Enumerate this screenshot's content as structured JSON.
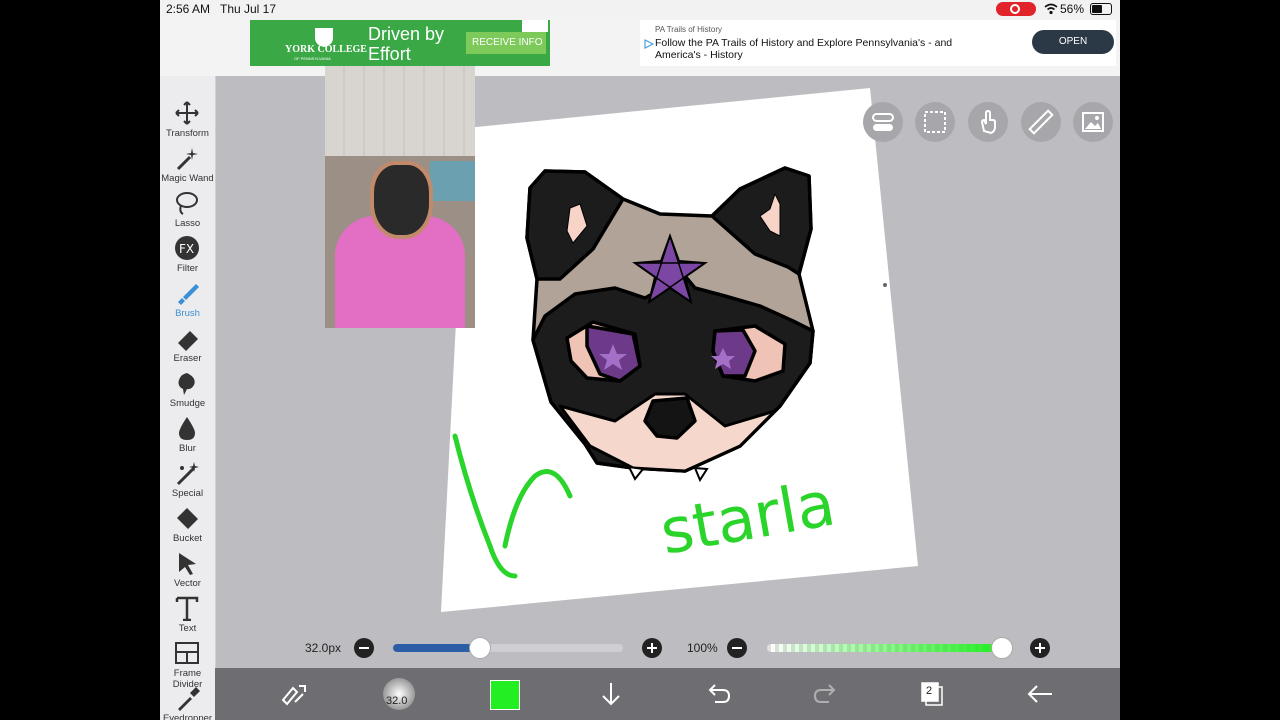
{
  "status": {
    "time": "2:56 AM",
    "date": "Thu Jul 17",
    "battery": "56%"
  },
  "ad_left": {
    "logo": "YORK COLLEGE",
    "logo_sub": "OF PENNSYLVANIA",
    "headline_1": "Driven by",
    "headline_2": "Effort",
    "cta": "RECEIVE INFO"
  },
  "ad_right": {
    "source": "PA Trails of History",
    "text_1": "Follow the PA Trails of History and Explore Pennsylvania's - and",
    "text_2": "America's - History",
    "cta": "OPEN"
  },
  "tools": [
    {
      "label": "Transform",
      "icon": "move-arrows-icon"
    },
    {
      "label": "Magic Wand",
      "icon": "magic-wand-icon"
    },
    {
      "label": "Lasso",
      "icon": "lasso-icon"
    },
    {
      "label": "Filter",
      "icon": "fx-icon"
    },
    {
      "label": "Brush",
      "icon": "brush-icon"
    },
    {
      "label": "Eraser",
      "icon": "eraser-icon"
    },
    {
      "label": "Smudge",
      "icon": "smudge-icon"
    },
    {
      "label": "Blur",
      "icon": "drop-icon"
    },
    {
      "label": "Special",
      "icon": "sparkle-icon"
    },
    {
      "label": "Bucket",
      "icon": "bucket-icon"
    },
    {
      "label": "Vector",
      "icon": "cursor-icon"
    },
    {
      "label": "Text",
      "icon": "text-icon"
    },
    {
      "label": "Frame Divider",
      "icon": "frame-divider-icon"
    },
    {
      "label": "Eyedropper",
      "icon": "eyedropper-icon"
    }
  ],
  "active_tool": "Brush",
  "canvas": {
    "signature": "starla"
  },
  "brush_size": {
    "label": "32.0px",
    "level": 0.38
  },
  "opacity": {
    "label": "100%",
    "level": 1.0
  },
  "bottom": {
    "brush_size_badge": "32.0",
    "color": "#22ee22",
    "layer_count": "2"
  }
}
